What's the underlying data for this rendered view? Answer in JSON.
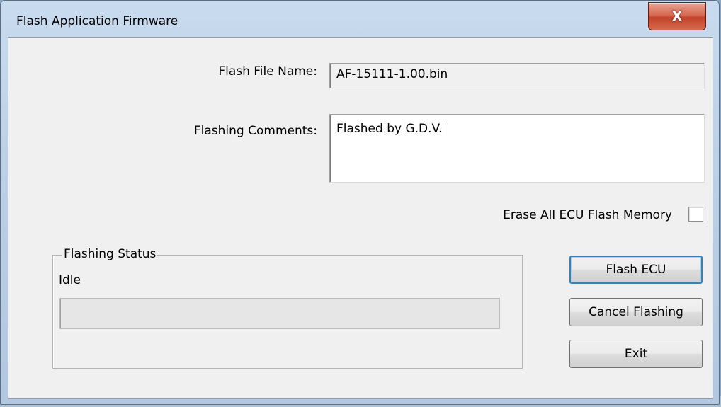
{
  "window": {
    "title": "Flash Application Firmware",
    "close_glyph": "X"
  },
  "form": {
    "file_name_label": "Flash File Name:",
    "file_name_value": "AF-15111-1.00.bin",
    "comments_label": "Flashing Comments:",
    "comments_value": "Flashed by G.D.V.",
    "erase_label": "Erase All ECU Flash Memory",
    "erase_checked": false
  },
  "status": {
    "group_title": "Flashing Status",
    "text": "Idle",
    "progress": 0
  },
  "buttons": {
    "flash": "Flash ECU",
    "cancel": "Cancel Flashing",
    "exit": "Exit"
  },
  "colors": {
    "close_button": "#c2432c",
    "title_bar": "#bcd0e6",
    "client_bg": "#f0f0f0",
    "default_button_border": "#3c7fb1"
  }
}
